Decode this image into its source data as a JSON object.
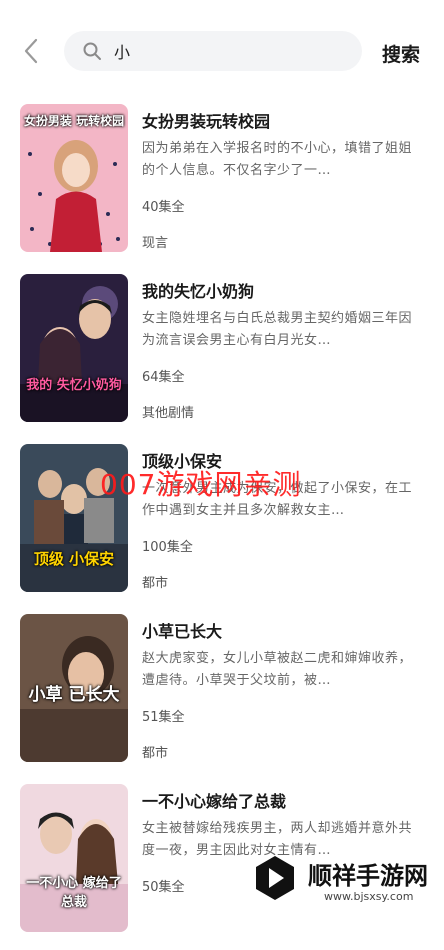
{
  "search": {
    "query": "小",
    "button_label": "搜索"
  },
  "results": [
    {
      "title": "女扮男装玩转校园",
      "description": "因为弟弟在入学报名时的不小心，填错了姐姐的个人信息。不仅名字少了一…",
      "episodes": "40集全",
      "genre": "现言",
      "cover_text": "女扮男装 玩转校园"
    },
    {
      "title": "我的失忆小奶狗",
      "description": "女主隐姓埋名与白氏总裁男主契约婚姻三年因为流言误会男主心有白月光女…",
      "episodes": "64集全",
      "genre": "其他剧情",
      "cover_text": "我的 失忆小奶狗"
    },
    {
      "title": "顶级小保安",
      "description": "一次意外男主成为保安，做起了小保安，在工作中遇到女主并且多次解救女主…",
      "episodes": "100集全",
      "genre": "都市",
      "cover_text": "顶级 小保安"
    },
    {
      "title": "小草已长大",
      "description": "赵大虎家变，女儿小草被赵二虎和婶婶收养，遭虐待。小草哭于父坟前，被…",
      "episodes": "51集全",
      "genre": "都市",
      "cover_text": "小草 已长大"
    },
    {
      "title": "一不小心嫁给了总裁",
      "description": "女主被替嫁给残疾男主，两人却逃婚并意外共度一夜，男主因此对女主情有…",
      "episodes": "50集全",
      "genre": "",
      "cover_text": "一不小心 嫁给了总裁"
    }
  ],
  "overlay": {
    "watermark": "007游戏网亲测",
    "brand_name": "顺祥手游网",
    "brand_url": "www.bjsxsy.com"
  },
  "colors": {
    "search_bg": "#f3f4f6",
    "watermark": "#ff1a1a"
  }
}
